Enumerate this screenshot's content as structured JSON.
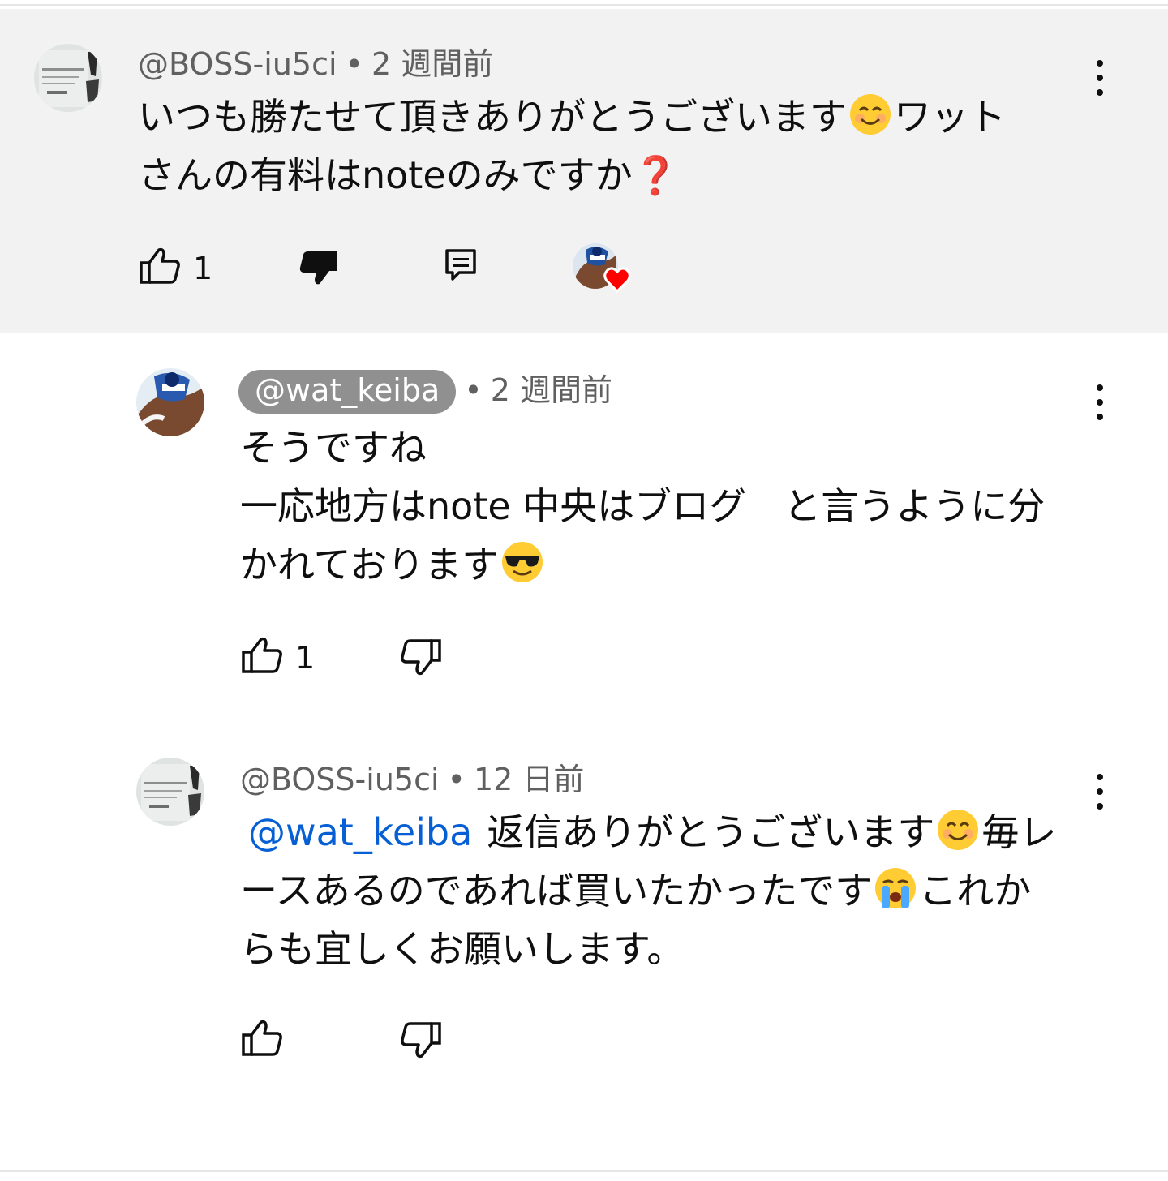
{
  "comments": [
    {
      "author": "@BOSS-iu5ci",
      "separator": "•",
      "time": "2 週間前",
      "lines": [
        "いつも勝たせて頂きありがとうございます",
        "ワット",
        "さんの有料はnoteのみですか",
        "❓"
      ],
      "likes": "1"
    },
    {
      "author": "@wat_keiba",
      "separator": "•",
      "time": "2 週間前",
      "lines": [
        "そうですね",
        "一応地方はnote 中央はブログ　と言うように分",
        "かれております"
      ],
      "likes": "1"
    },
    {
      "author": "@BOSS-iu5ci",
      "separator": "•",
      "time": "12 日前",
      "mention": "@wat_keiba",
      "lines": [
        "返信ありがとうございます",
        "毎レ",
        "ースあるのであれば買いたかったです",
        "これか",
        "らも宜しくお願いします。"
      ],
      "likes": ""
    }
  ],
  "icons": {
    "like": "thumb-up-icon",
    "dislike": "thumb-down-icon",
    "reply": "reply-icon",
    "more": "more-vertical-icon",
    "heart": "creator-heart-icon"
  },
  "colors": {
    "highlight_bg": "#f2f2f2",
    "mention": "#065fd4",
    "meta": "#606060",
    "chip": "#909090",
    "heart": "#ff0000"
  }
}
